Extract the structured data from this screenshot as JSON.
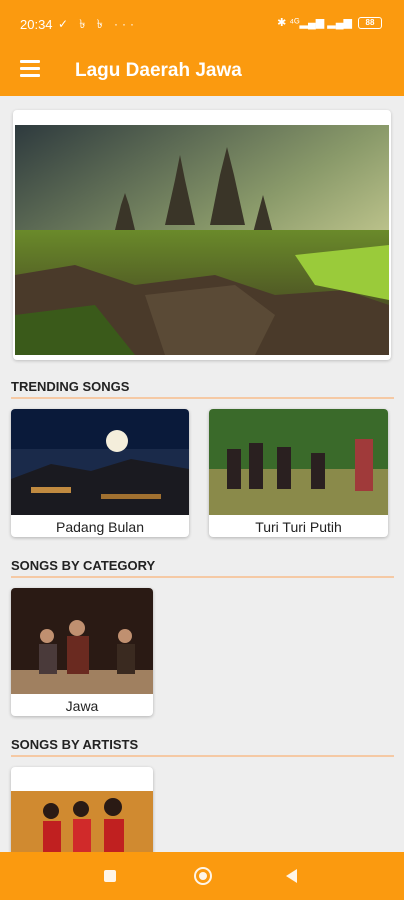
{
  "status_bar": {
    "time": "20:34",
    "left_icons": "✓ ৳ ৳ ···",
    "right_icons": "✱ ⁴ᴳ▂▄▆ ▂▄▆",
    "battery": "88"
  },
  "app_bar": {
    "title": "Lagu Daerah Jawa",
    "menu_icon": "hamburger-menu-icon"
  },
  "sections": {
    "trending": {
      "title": "TRENDING SONGS",
      "items": [
        {
          "label": "Padang Bulan"
        },
        {
          "label": "Turi Turi Putih"
        }
      ]
    },
    "category": {
      "title": "SONGS BY CATEGORY",
      "items": [
        {
          "label": "Jawa"
        }
      ]
    },
    "artists": {
      "title": "SONGS BY ARTISTS"
    }
  },
  "nav_bar": {
    "icons": [
      "recent-apps-icon",
      "home-icon",
      "back-icon"
    ]
  },
  "colors": {
    "accent": "#fb9a0f",
    "divider": "#f5c9a4",
    "background": "#eeeeee"
  }
}
